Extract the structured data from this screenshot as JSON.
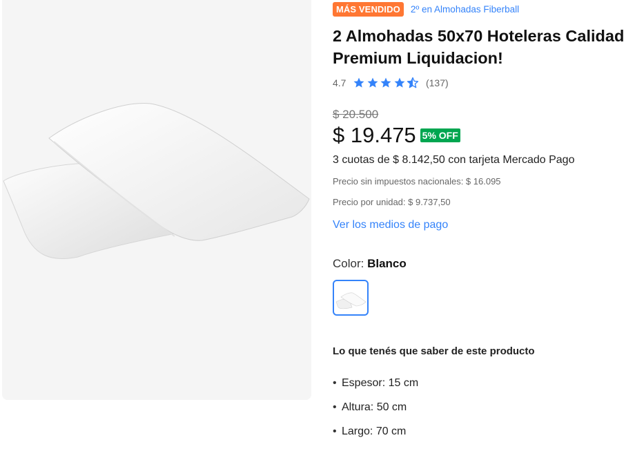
{
  "product": {
    "badge": "MÁS VENDIDO",
    "rank_text": "2º en Almohadas Fiberball",
    "title": "2 Almohadas 50x70 Hoteleras Calidad Premium Liquidacion!",
    "rating": "4.7",
    "rating_stars": 4.7,
    "reviews": "(137)",
    "old_price": "$ 20.500",
    "price": "$ 19.475",
    "discount": "5% OFF",
    "installments": "3 cuotas de $ 8.142,50 con tarjeta Mercado Pago",
    "tax_note": "Precio sin impuestos nacionales: $ 16.095",
    "unit_price": "Precio por unidad: $ 9.737,50",
    "payment_link": "Ver los medios de pago",
    "color_label": "Color:",
    "color_value": "Blanco",
    "know_title": "Lo que tenés que saber de este producto",
    "specs": [
      "Espesor: 15 cm",
      "Altura: 50 cm",
      "Largo: 70 cm"
    ]
  },
  "colors": {
    "accent": "#3483fa",
    "badge": "#ff7733",
    "discount": "#00a650",
    "gallery_bg": "#f5f5f5"
  },
  "icons": [
    "star-icon",
    "star-half-icon",
    "bullet-icon"
  ]
}
